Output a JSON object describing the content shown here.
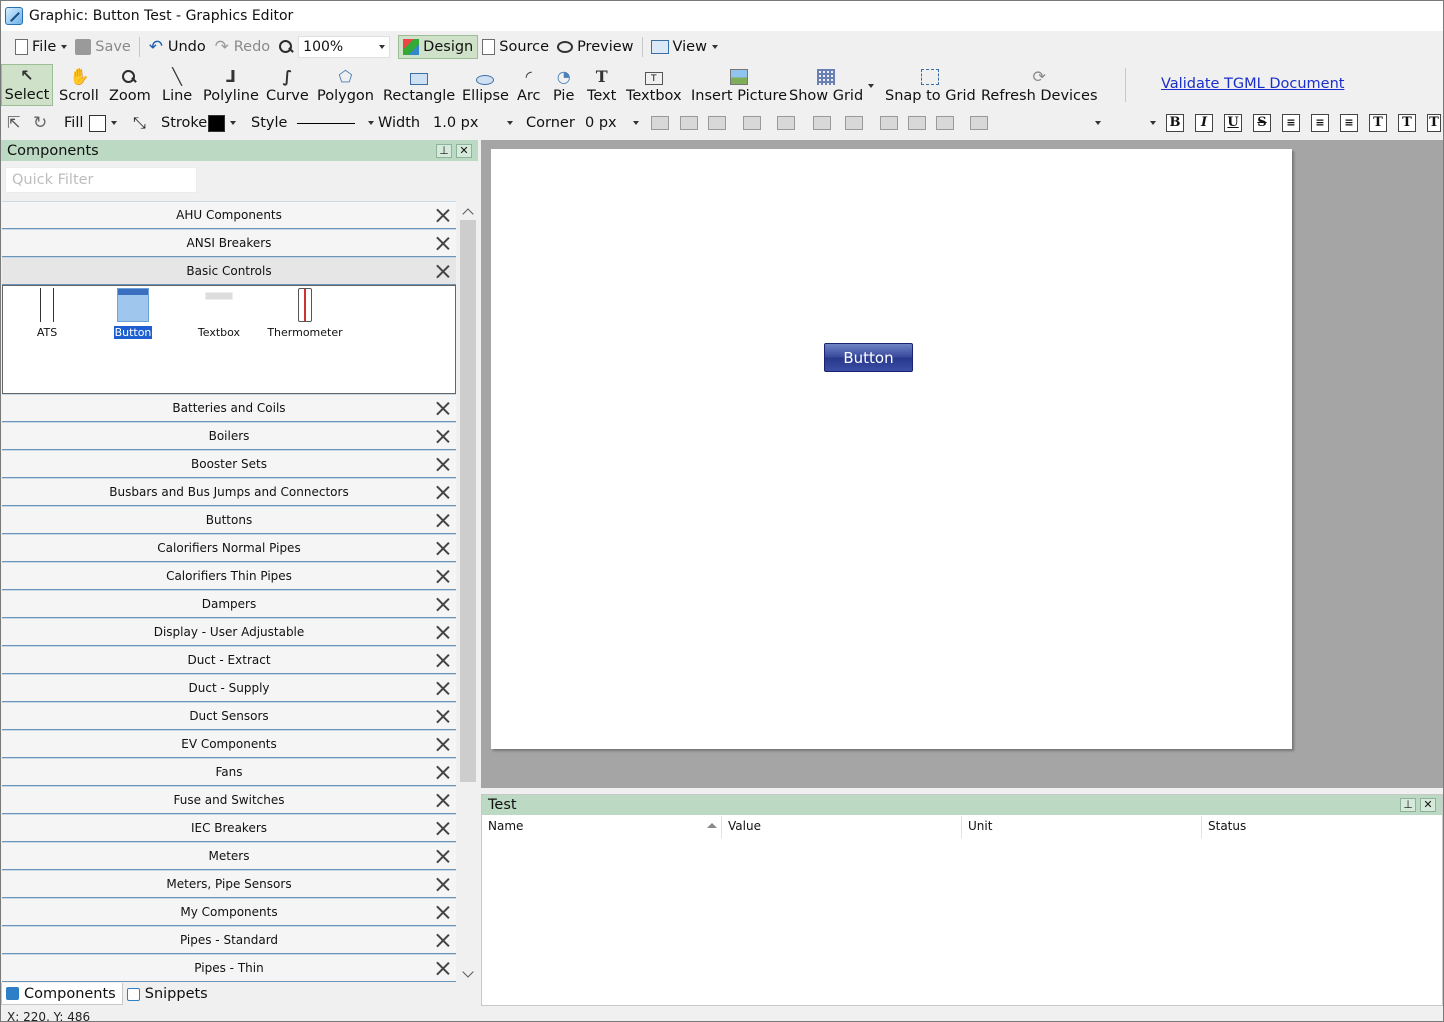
{
  "window": {
    "title": "Graphic: Button Test - Graphics Editor"
  },
  "toolbar": {
    "file": "File",
    "save": "Save",
    "undo": "Undo",
    "redo": "Redo",
    "zoom": "100%",
    "design": "Design",
    "source": "Source",
    "preview": "Preview",
    "view": "View"
  },
  "tools": {
    "select": "Select",
    "scroll": "Scroll",
    "zoom": "Zoom",
    "line": "Line",
    "polyline": "Polyline",
    "curve": "Curve",
    "polygon": "Polygon",
    "rectangle": "Rectangle",
    "ellipse": "Ellipse",
    "arc": "Arc",
    "pie": "Pie",
    "text": "Text",
    "textbox": "Textbox",
    "insert_picture": "Insert Picture",
    "show_grid": "Show Grid",
    "snap_to_grid": "Snap to Grid",
    "refresh_devices": "Refresh Devices",
    "validate": "Validate TGML Document"
  },
  "properties": {
    "fill": "Fill",
    "fill_color": "#ffffff",
    "stroke": "Stroke",
    "stroke_color": "#000000",
    "style": "Style",
    "width_label": "Width",
    "width_value": "1.0 px",
    "corner_label": "Corner",
    "corner_value": "0 px",
    "bold": "B",
    "italic": "I",
    "underline": "U",
    "strike": "S",
    "text_t": "T"
  },
  "components_panel": {
    "title": "Components",
    "filter_placeholder": "Quick Filter",
    "categories_before": [
      "AHU Components",
      "ANSI Breakers"
    ],
    "expanded_category": "Basic Controls",
    "basic_controls": [
      "ATS",
      "Button",
      "Textbox",
      "Thermometer"
    ],
    "categories_after": [
      "Batteries and Coils",
      "Boilers",
      "Booster Sets",
      "Busbars and Bus Jumps and Connectors",
      "Buttons",
      "Calorifiers Normal Pipes",
      "Calorifiers Thin Pipes",
      "Dampers",
      "Display - User Adjustable",
      "Duct - Extract",
      "Duct - Supply",
      "Duct Sensors",
      "EV Components",
      "Fans",
      "Fuse and Switches",
      "IEC Breakers",
      "Meters",
      "Meters, Pipe Sensors",
      "My Components",
      "Pipes - Standard",
      "Pipes - Thin"
    ],
    "tabs": [
      "Components",
      "Snippets"
    ]
  },
  "canvas": {
    "button_label": "Button"
  },
  "test_panel": {
    "title": "Test",
    "columns": [
      "Name",
      "Value",
      "Unit",
      "Status"
    ]
  },
  "status": {
    "coords": "X: 220, Y: 486"
  },
  "colors": {
    "panel_header": "#bcd9c3",
    "accent_blue": "#1d5fd1",
    "button_blue": "#36479b"
  }
}
